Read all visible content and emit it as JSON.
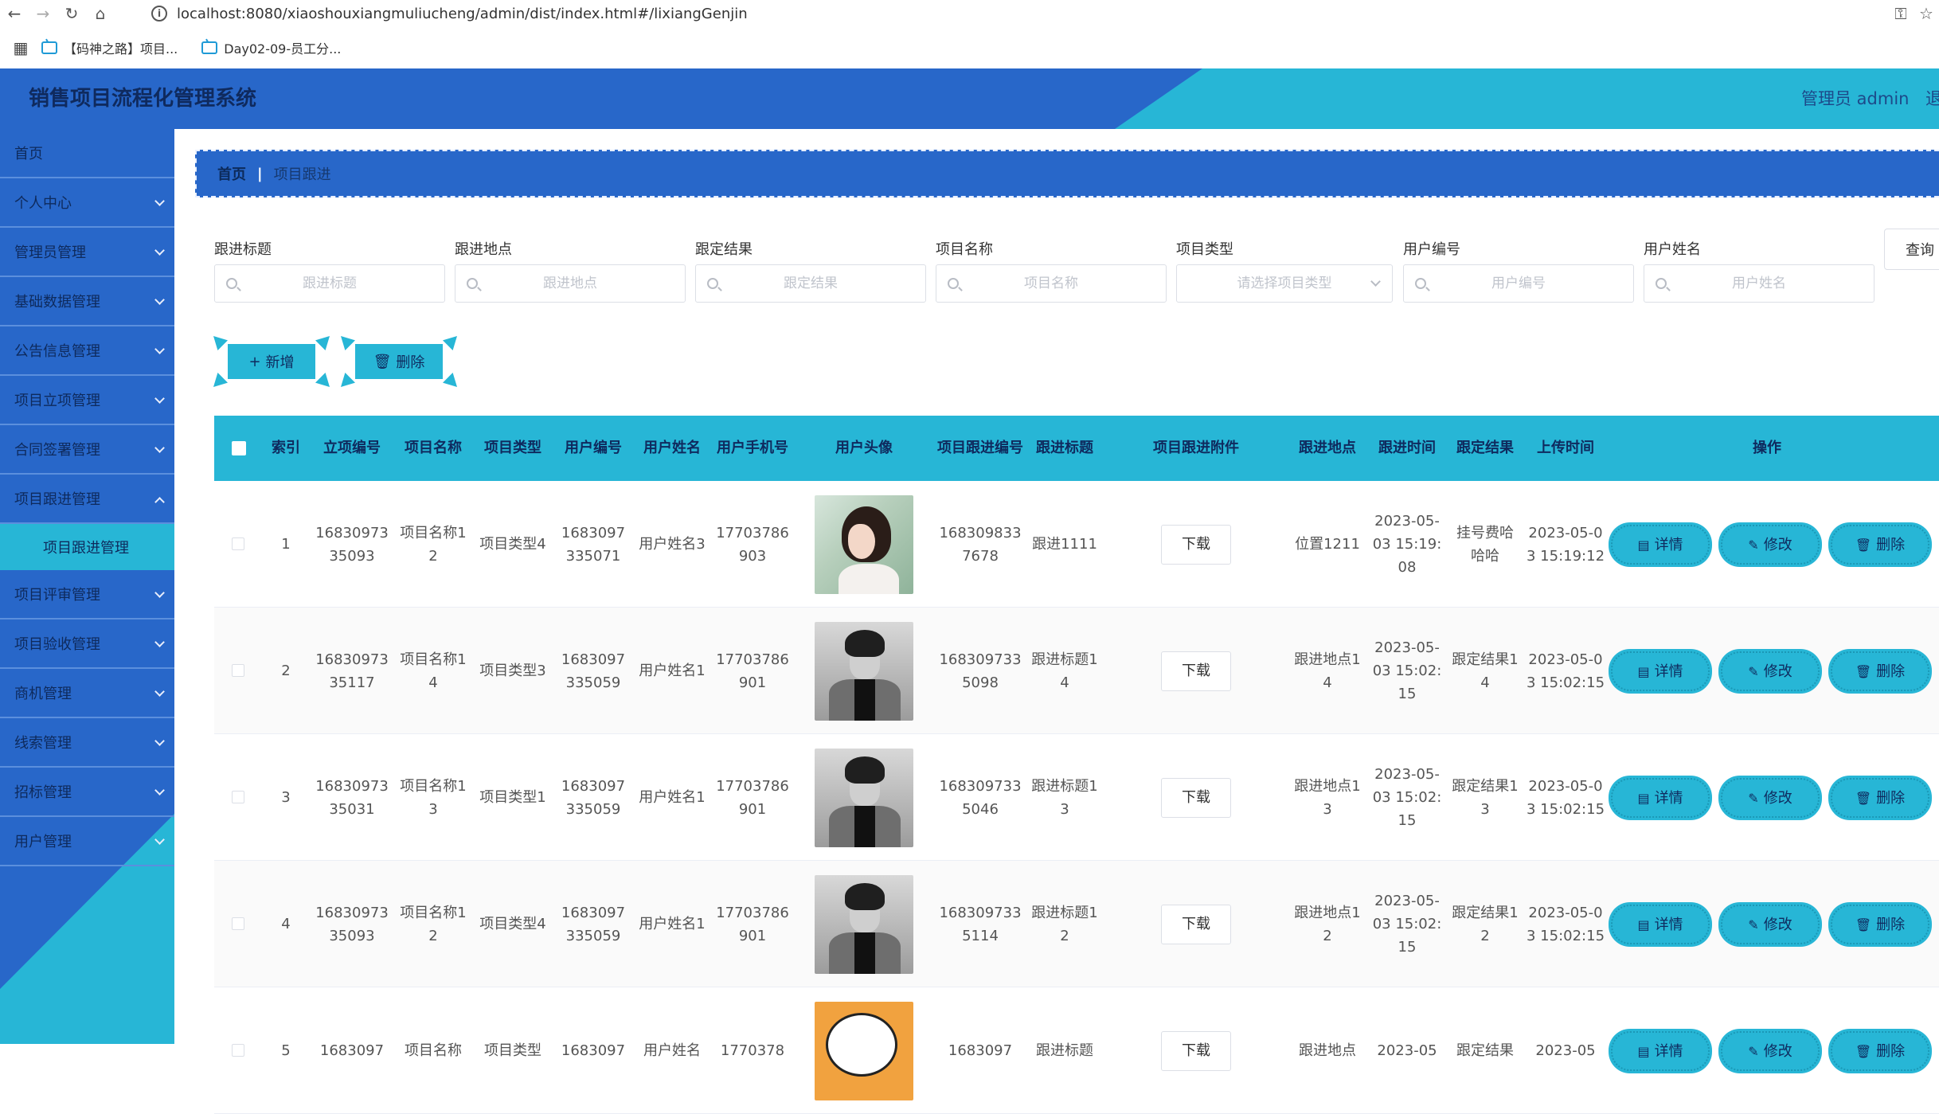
{
  "browser": {
    "url": "localhost:8080/xiaoshouxiangmuliucheng/admin/dist/index.html#/lixiangGenjin",
    "bookmarks": [
      "【码神之路】项目...",
      "Day02-09-员工分..."
    ]
  },
  "app": {
    "title": "销售项目流程化管理系统",
    "admin_label": "管理员 admin",
    "logout_label": "退"
  },
  "sidebar": {
    "items": [
      {
        "label": "首页",
        "chevron": false
      },
      {
        "label": "个人中心",
        "chevron": true
      },
      {
        "label": "管理员管理",
        "chevron": true
      },
      {
        "label": "基础数据管理",
        "chevron": true
      },
      {
        "label": "公告信息管理",
        "chevron": true
      },
      {
        "label": "项目立项管理",
        "chevron": true
      },
      {
        "label": "合同签署管理",
        "chevron": true
      },
      {
        "label": "项目跟进管理",
        "chevron": true,
        "expanded": true
      },
      {
        "label": "项目评审管理",
        "chevron": true
      },
      {
        "label": "项目验收管理",
        "chevron": true
      },
      {
        "label": "商机管理",
        "chevron": true
      },
      {
        "label": "线索管理",
        "chevron": true
      },
      {
        "label": "招标管理",
        "chevron": true
      },
      {
        "label": "用户管理",
        "chevron": true
      }
    ],
    "sub_item": "项目跟进管理"
  },
  "breadcrumb": {
    "home": "首页",
    "separator": "|",
    "current": "项目跟进"
  },
  "search": {
    "fields": [
      {
        "label": "跟进标题",
        "placeholder": "跟进标题"
      },
      {
        "label": "跟进地点",
        "placeholder": "跟进地点"
      },
      {
        "label": "跟定结果",
        "placeholder": "跟定结果"
      },
      {
        "label": "项目名称",
        "placeholder": "项目名称"
      },
      {
        "label": "项目类型",
        "placeholder": "请选择项目类型"
      },
      {
        "label": "用户编号",
        "placeholder": "用户编号"
      },
      {
        "label": "用户姓名",
        "placeholder": "用户姓名"
      }
    ],
    "query_label": "查询"
  },
  "actions": {
    "add_label": "新增",
    "delete_label": "删除"
  },
  "table": {
    "headers": {
      "index": "索引",
      "lixiang_no": "立项编号",
      "project_name": "项目名称",
      "project_type": "项目类型",
      "user_no": "用户编号",
      "user_name": "用户姓名",
      "user_phone": "用户手机号",
      "avatar": "用户头像",
      "genjin_no": "项目跟进编号",
      "title": "跟进标题",
      "attachment": "项目跟进附件",
      "location": "跟进地点",
      "time": "跟进时间",
      "result": "跟定结果",
      "upload_time": "上传时间",
      "ops": "操作"
    },
    "download_label": "下载",
    "op_labels": {
      "detail": "详情",
      "edit": "修改",
      "delete": "删除"
    },
    "rows": [
      {
        "index": "1",
        "lixiang_no": "1683097335093",
        "project_name": "项目名称12",
        "project_type": "项目类型4",
        "user_no": "1683097335071",
        "user_name": "用户姓名3",
        "user_phone": "17703786903",
        "avatar": "girl",
        "genjin_no": "1683098337678",
        "title": "跟进1111",
        "location": "位置1211",
        "time": "2023-05-03 15:19:08",
        "result": "挂号费哈哈哈",
        "upload_time": "2023-05-03 15:19:12"
      },
      {
        "index": "2",
        "lixiang_no": "1683097335117",
        "project_name": "项目名称14",
        "project_type": "项目类型3",
        "user_no": "1683097335059",
        "user_name": "用户姓名1",
        "user_phone": "17703786901",
        "avatar": "man",
        "genjin_no": "1683097335098",
        "title": "跟进标题14",
        "location": "跟进地点14",
        "time": "2023-05-03 15:02:15",
        "result": "跟定结果14",
        "upload_time": "2023-05-03 15:02:15"
      },
      {
        "index": "3",
        "lixiang_no": "1683097335031",
        "project_name": "项目名称13",
        "project_type": "项目类型1",
        "user_no": "1683097335059",
        "user_name": "用户姓名1",
        "user_phone": "17703786901",
        "avatar": "man",
        "genjin_no": "1683097335046",
        "title": "跟进标题13",
        "location": "跟进地点13",
        "time": "2023-05-03 15:02:15",
        "result": "跟定结果13",
        "upload_time": "2023-05-03 15:02:15"
      },
      {
        "index": "4",
        "lixiang_no": "1683097335093",
        "project_name": "项目名称12",
        "project_type": "项目类型4",
        "user_no": "1683097335059",
        "user_name": "用户姓名1",
        "user_phone": "17703786901",
        "avatar": "man",
        "genjin_no": "1683097335114",
        "title": "跟进标题12",
        "location": "跟进地点12",
        "time": "2023-05-03 15:02:15",
        "result": "跟定结果12",
        "upload_time": "2023-05-03 15:02:15"
      },
      {
        "index": "5",
        "lixiang_no": "1683097",
        "project_name": "项目名称",
        "project_type": "项目类型",
        "user_no": "1683097",
        "user_name": "用户姓名",
        "user_phone": "1770378",
        "avatar": "cartoon",
        "genjin_no": "1683097",
        "title": "跟进标题",
        "location": "跟进地点",
        "time": "2023-05",
        "result": "跟定结果",
        "upload_time": "2023-05"
      }
    ]
  },
  "colors": {
    "primary_blue": "#2867c9",
    "accent_cyan": "#27b6d6",
    "dark_text": "#0f2a5e"
  }
}
